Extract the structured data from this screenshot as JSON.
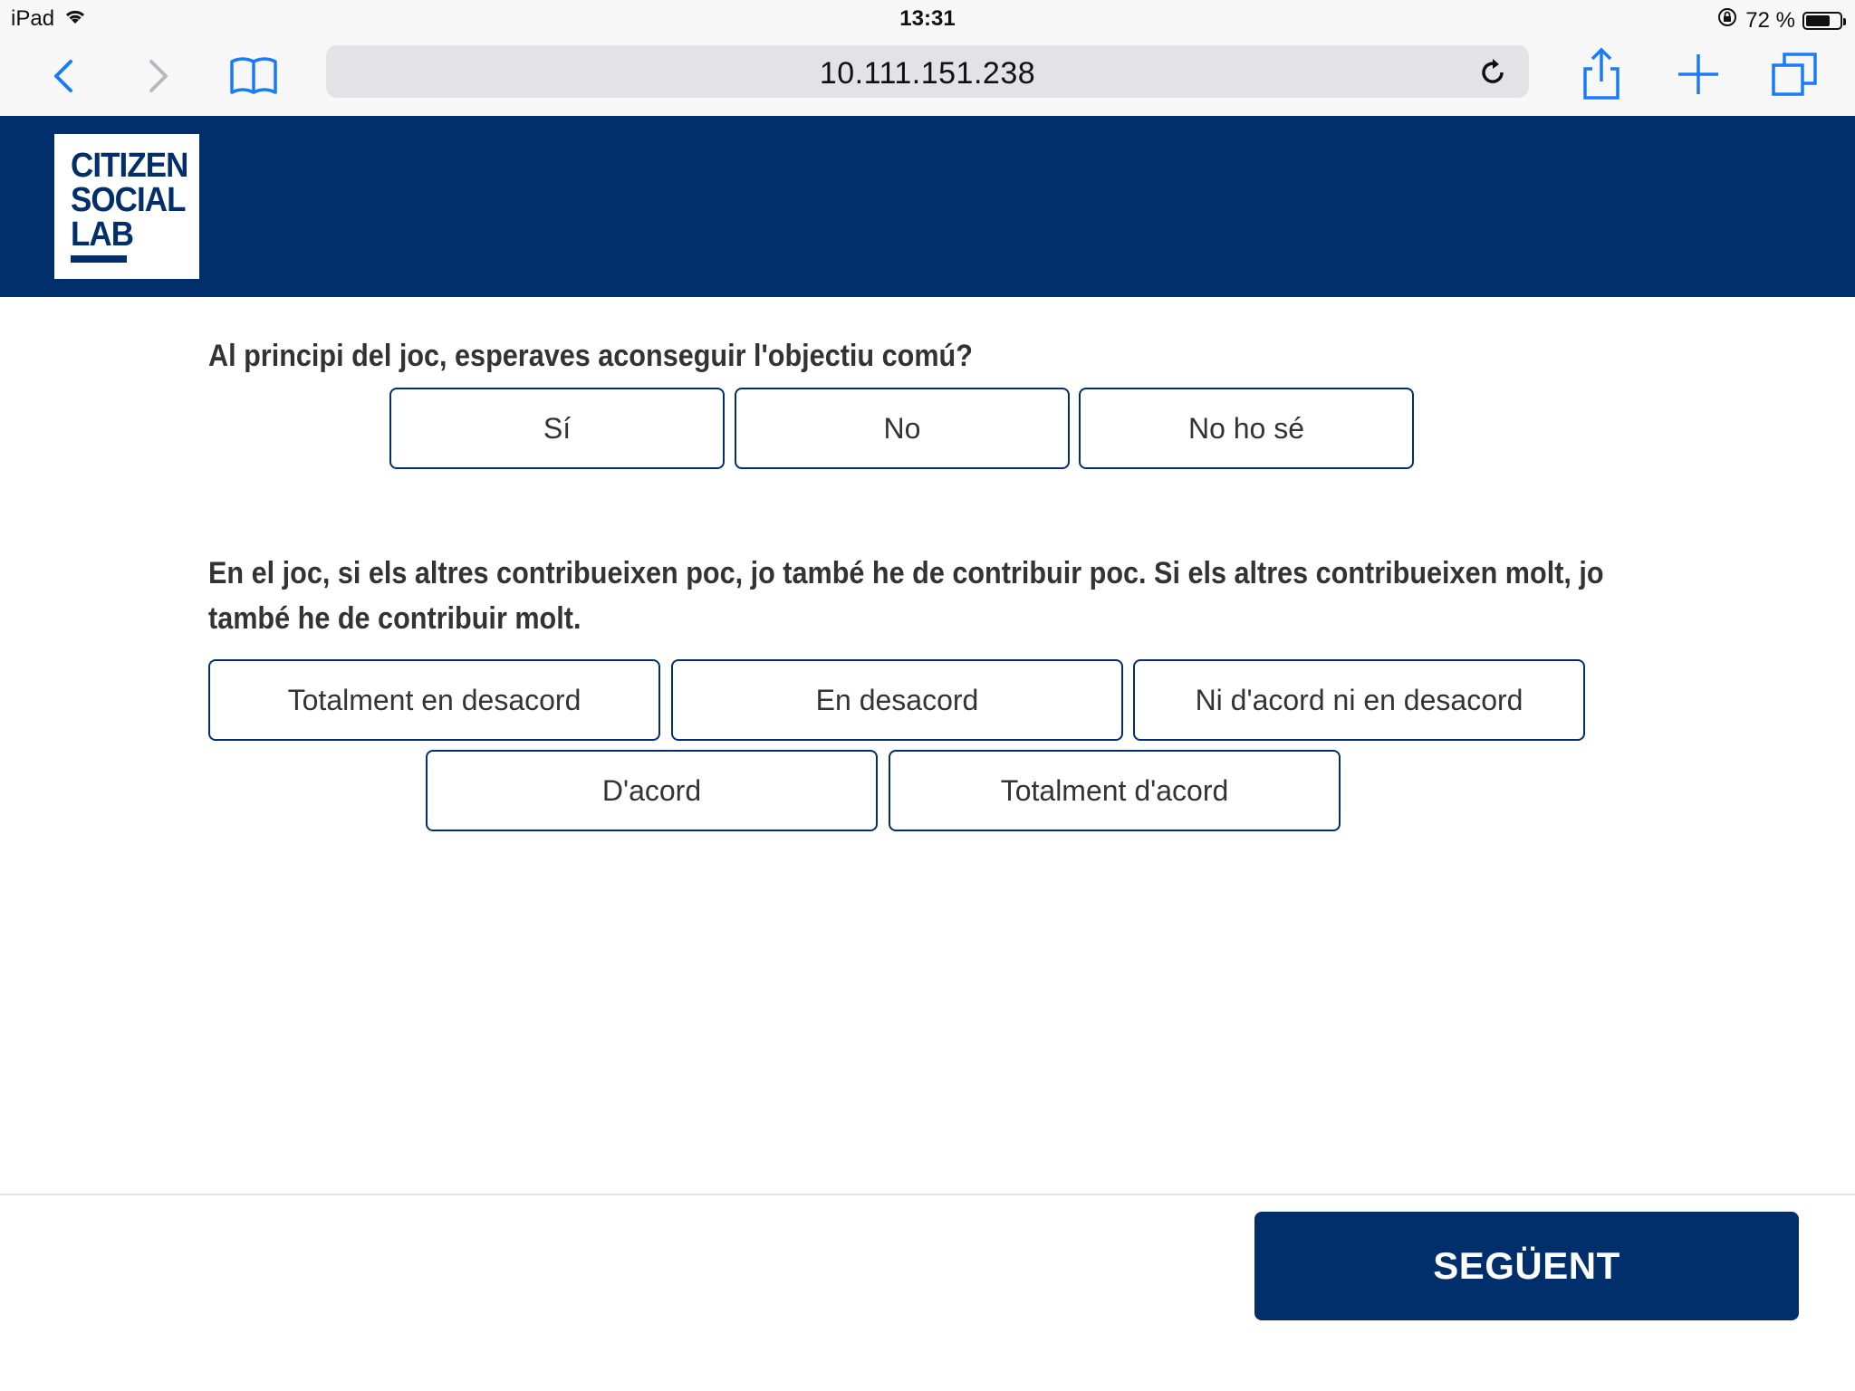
{
  "status_bar": {
    "device": "iPad",
    "time": "13:31",
    "battery": "72 %",
    "battery_level": 0.72,
    "icons": [
      "wifi-icon",
      "rotation-lock-icon",
      "battery-icon"
    ]
  },
  "browser": {
    "url": "10.111.151.238",
    "icons": [
      "back-icon",
      "forward-icon",
      "bookmarks-icon",
      "reload-icon",
      "share-icon",
      "new-tab-icon",
      "tabs-icon"
    ],
    "accent_color": "#1a7cf5"
  },
  "header": {
    "logo_lines": [
      "CITIZEN",
      "SOCIAL",
      "LAB"
    ],
    "background_color": "#002f6c"
  },
  "question1": {
    "text": "Al principi del joc, esperaves aconseguir l'objectiu comú?",
    "options": [
      "Sí",
      "No",
      "No ho sé"
    ]
  },
  "question2": {
    "text": "En el joc, si els altres contribueixen poc, jo també he de contribuir poc. Si els altres contribueixen molt, jo també he de contribuir molt.",
    "options": [
      "Totalment en desacord",
      "En desacord",
      "Ni d'acord ni en desacord",
      "D'acord",
      "Totalment d'acord"
    ]
  },
  "footer": {
    "next_label": "SEGÜENT"
  }
}
